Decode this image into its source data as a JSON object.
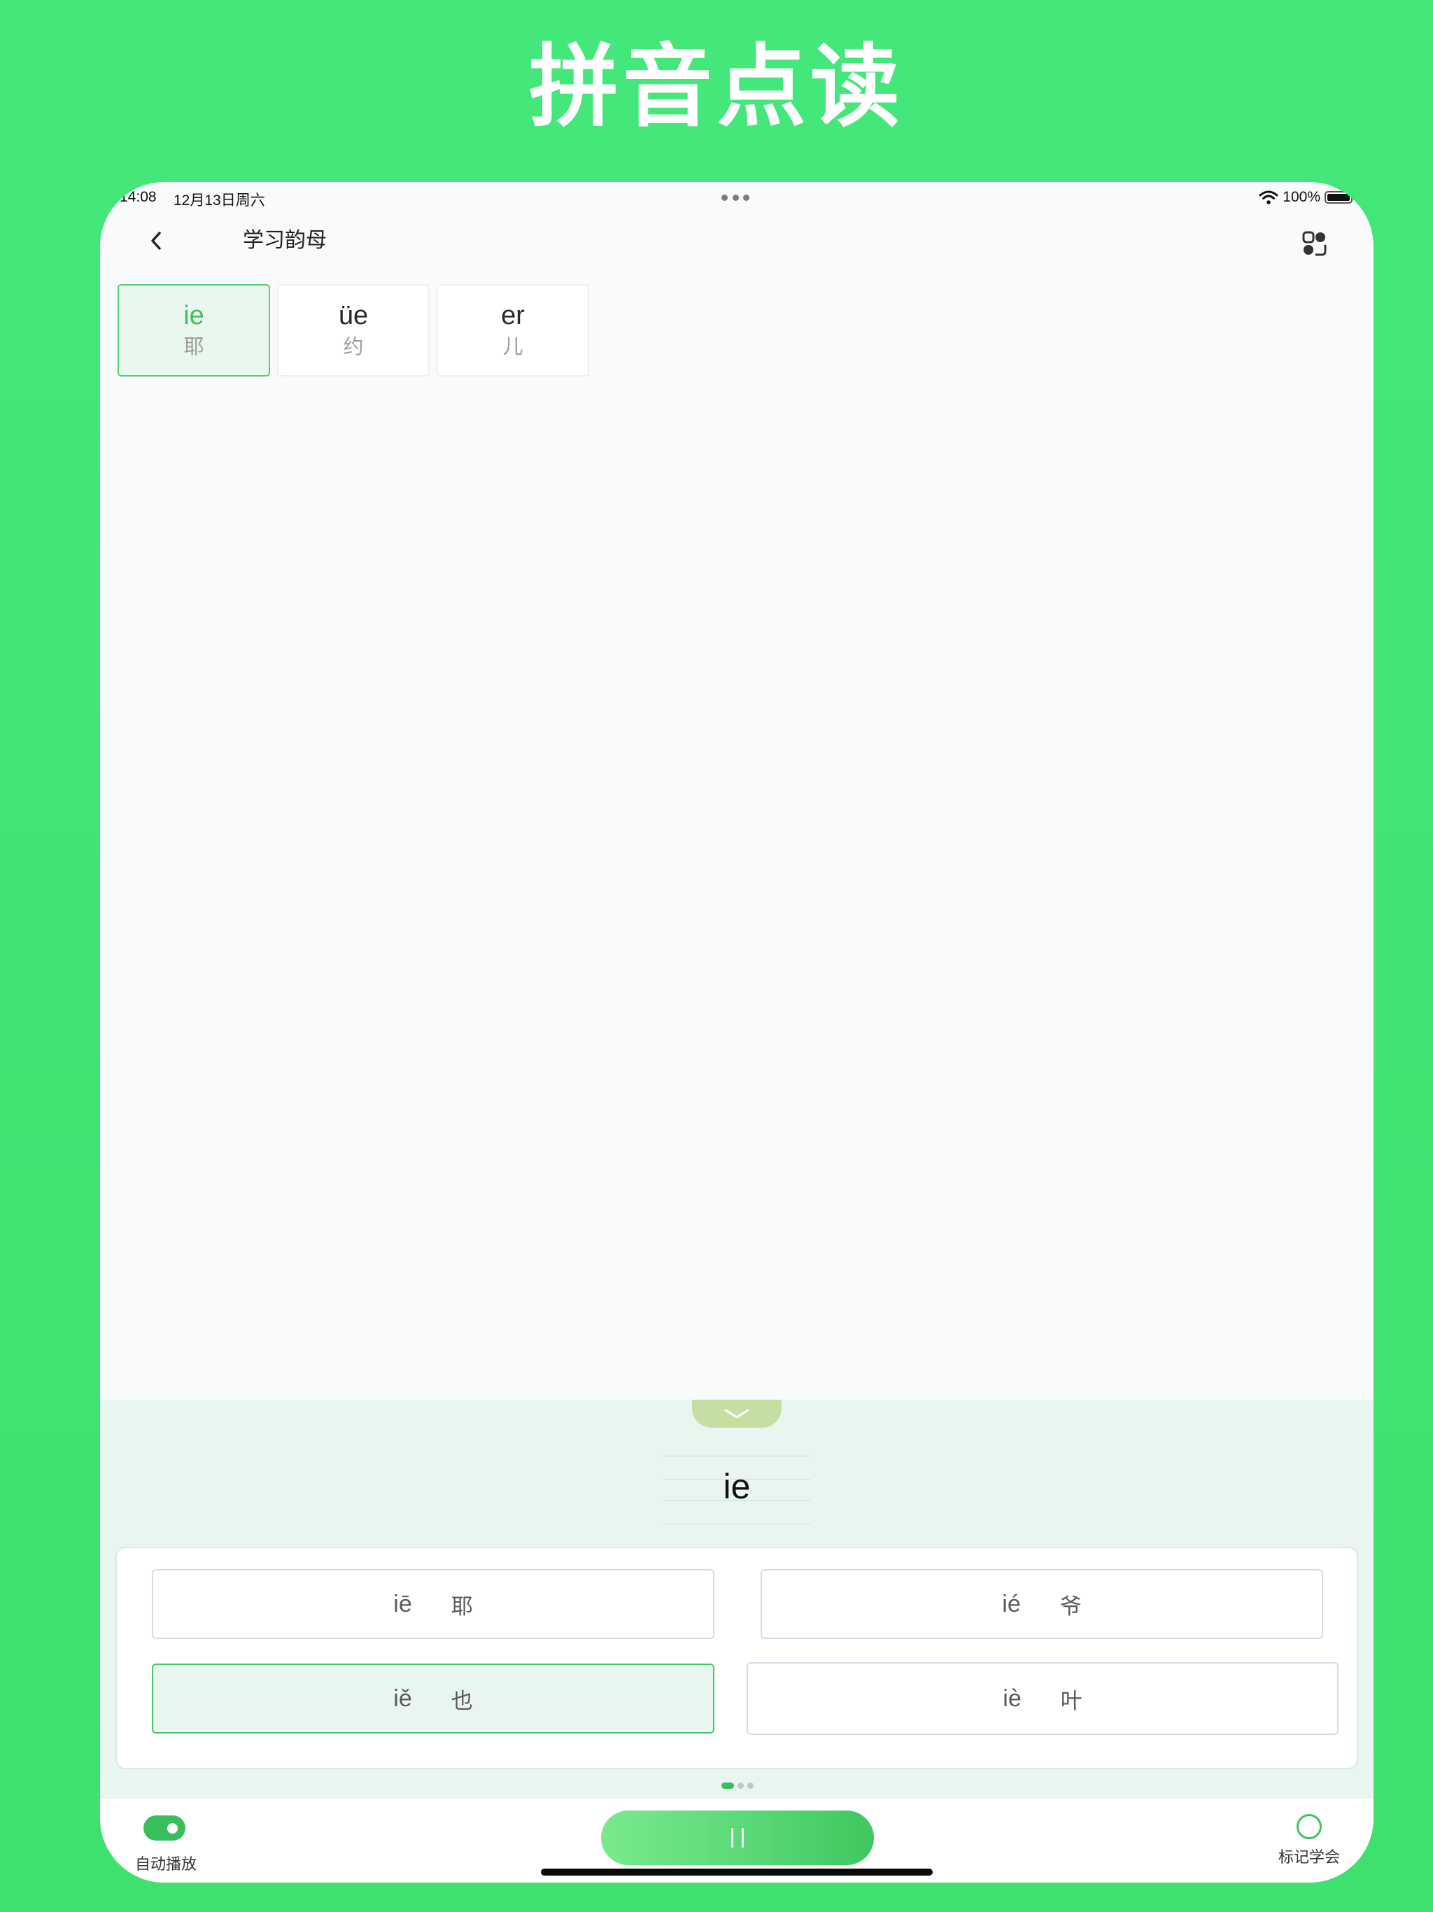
{
  "headline": "拼音点读",
  "status_bar": {
    "time": "14:08",
    "date": "12月13日周六",
    "battery": "100%"
  },
  "nav": {
    "title": "学习韵母"
  },
  "tabs": [
    {
      "pinyin": "ie",
      "hanzi": "耶",
      "active": true
    },
    {
      "pinyin": "üe",
      "hanzi": "约",
      "active": false
    },
    {
      "pinyin": "er",
      "hanzi": "儿",
      "active": false
    }
  ],
  "current": {
    "pinyin": "ie"
  },
  "words": [
    {
      "pinyin": "iē",
      "hanzi": "耶"
    },
    {
      "pinyin": "ié",
      "hanzi": "爷"
    },
    {
      "pinyin": "iě",
      "hanzi": "也",
      "selected": true
    },
    {
      "pinyin": "iè",
      "hanzi": "叶"
    }
  ],
  "pager": {
    "count": 3,
    "current": 1
  },
  "toolbar": {
    "auto_play_label": "自动播放",
    "auto_play_on": true,
    "mark_learned_label": "标记学会"
  },
  "icons": {
    "back": "chevron-left-icon",
    "switch": "switch-icon",
    "collapse": "chevron-down-icon",
    "play": "pause-icon"
  },
  "colors": {
    "brand_green": "#3ee16e",
    "accent_green": "#3fbf5e",
    "panel_bg": "#e9f5ef"
  }
}
